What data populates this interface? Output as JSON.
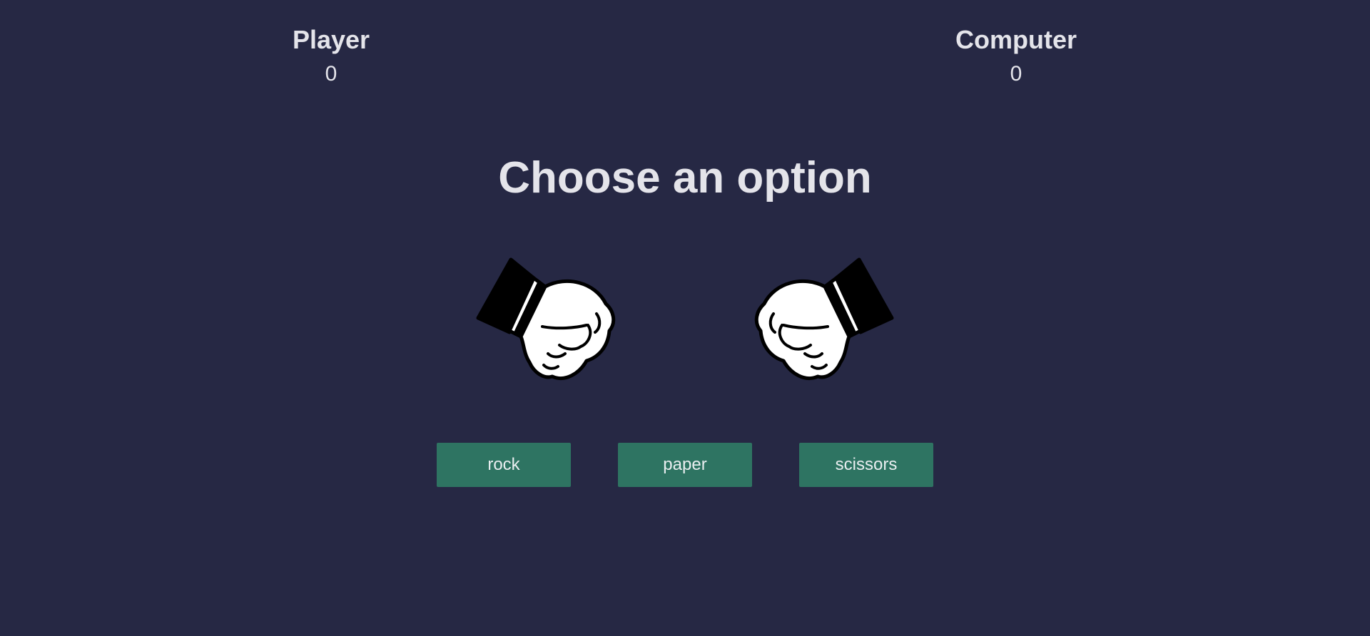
{
  "scoreboard": {
    "player": {
      "label": "Player",
      "score": "0"
    },
    "computer": {
      "label": "Computer",
      "score": "0"
    }
  },
  "prompt": "Choose an option",
  "hands": {
    "player": {
      "icon": "rock-fist-icon"
    },
    "computer": {
      "icon": "rock-fist-icon"
    }
  },
  "choices": [
    {
      "label": "rock"
    },
    {
      "label": "paper"
    },
    {
      "label": "scissors"
    }
  ],
  "colors": {
    "background": "#262844",
    "text": "#e4e4ea",
    "button": "#2e7462",
    "button_text": "#e9eef0"
  }
}
